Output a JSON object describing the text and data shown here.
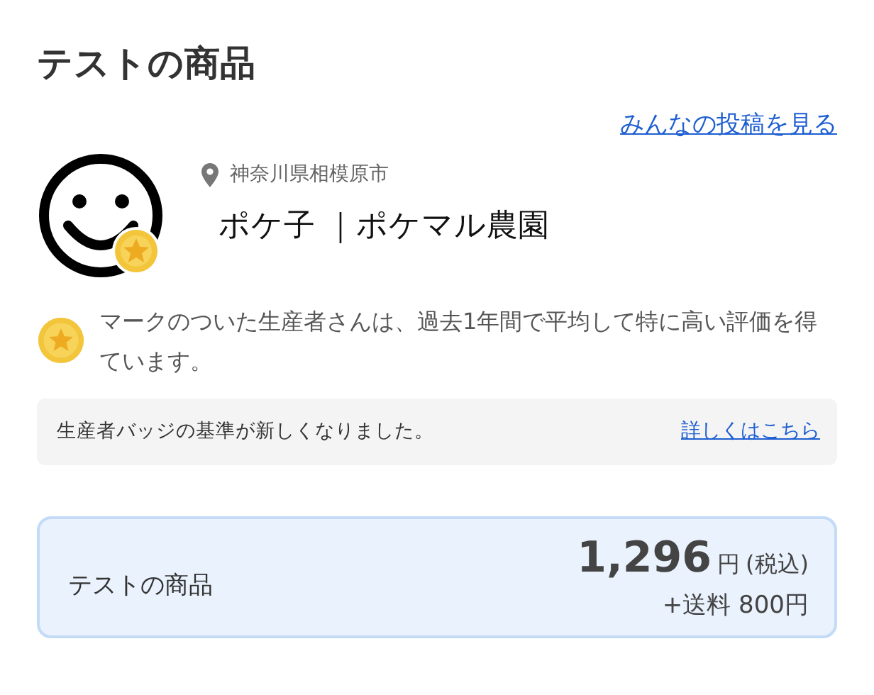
{
  "title": "テストの商品",
  "posts_link": "みんなの投稿を見る",
  "producer": {
    "location": "神奈川県相模原市",
    "name": "ポケ子 ｜ポケマル農園",
    "badge": true
  },
  "badge_note": "マークのついた生産者さんは、過去1年間で平均して特に高い評価を得ています。",
  "notice": {
    "text": "生産者バッジの基準が新しくなりました。",
    "link": "詳しくはこちら"
  },
  "product": {
    "name": "テストの商品",
    "price": "1,296",
    "unit": "円",
    "tax": "(税込)",
    "shipping": "+送料 800円"
  }
}
